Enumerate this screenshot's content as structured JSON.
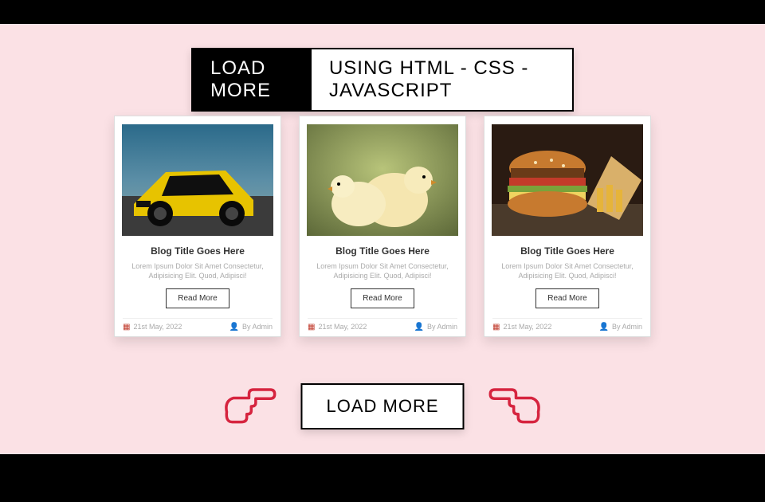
{
  "header": {
    "left_label": "LOAD MORE",
    "right_label": "USING HTML - CSS - JAVASCRIPT"
  },
  "cards": [
    {
      "title": "Blog Title Goes Here",
      "excerpt": "Lorem Ipsum Dolor Sit Amet Consectetur, Adipisicing Elit. Quod, Adipisci!",
      "read_more": "Read More",
      "date": "21st May, 2022",
      "author": "By Admin",
      "image_alt": "yellow-sports-car"
    },
    {
      "title": "Blog Title Goes Here",
      "excerpt": "Lorem Ipsum Dolor Sit Amet Consectetur, Adipisicing Elit. Quod, Adipisci!",
      "read_more": "Read More",
      "date": "21st May, 2022",
      "author": "By Admin",
      "image_alt": "baby-chicks"
    },
    {
      "title": "Blog Title Goes Here",
      "excerpt": "Lorem Ipsum Dolor Sit Amet Consectetur, Adipisicing Elit. Quod, Adipisci!",
      "read_more": "Read More",
      "date": "21st May, 2022",
      "author": "By Admin",
      "image_alt": "burger-and-fries"
    }
  ],
  "load_more_button": "LOAD MORE",
  "icons": {
    "hand_left": "pointing-hand-right-icon",
    "hand_right": "pointing-hand-left-icon"
  }
}
